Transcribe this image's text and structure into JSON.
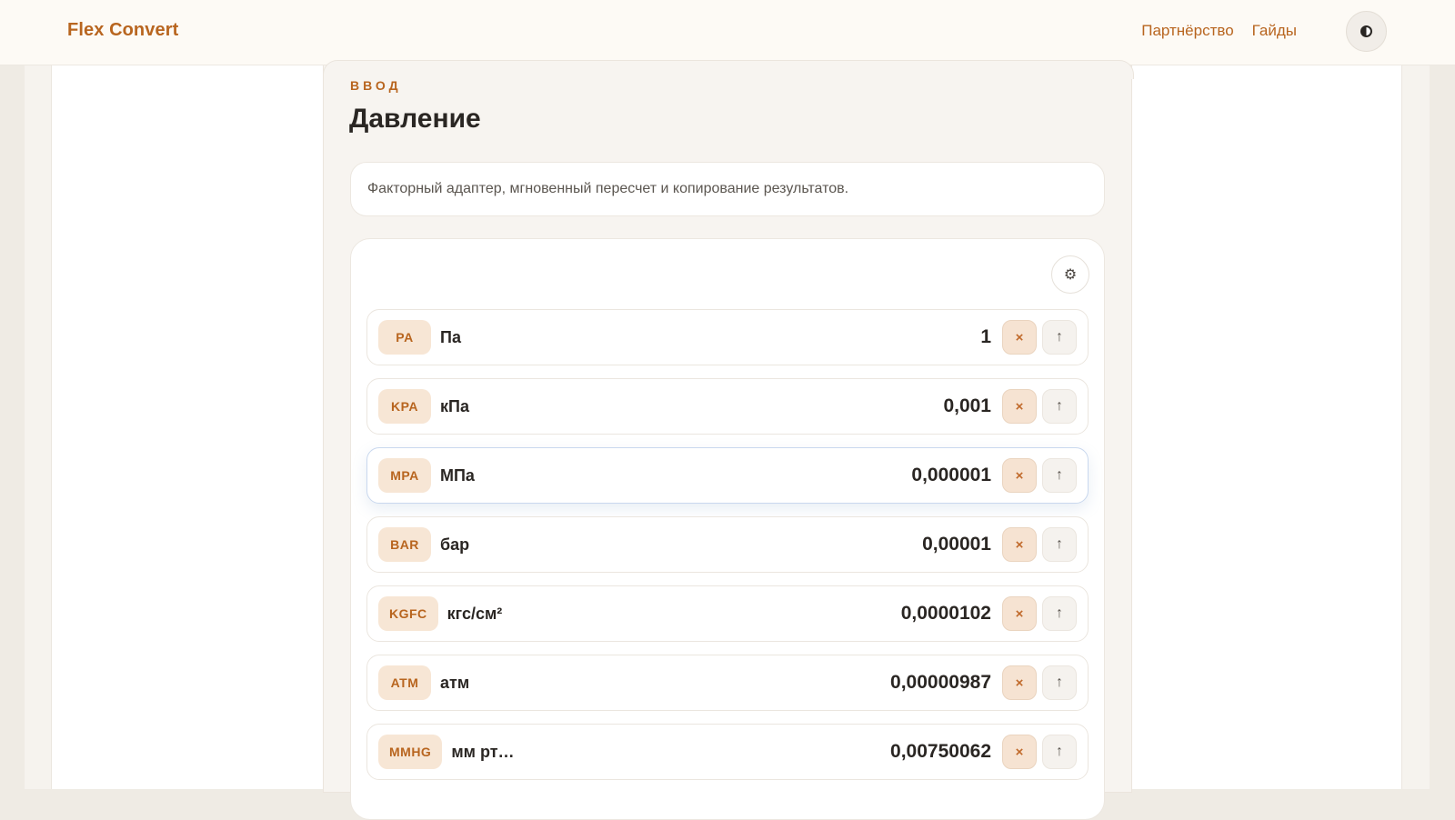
{
  "header": {
    "brand": "Flex Convert",
    "nav": [
      "Партнёрство",
      "Гайды"
    ],
    "theme_icon": "contrast-icon"
  },
  "section": {
    "eyebrow": "ВВОД",
    "title": "Давление",
    "description": "Факторный адаптер, мгновенный пересчет и копирование результатов."
  },
  "settings_icon": "gear-icon",
  "rows": [
    {
      "badge": "PA",
      "unit": "Па",
      "value": "1",
      "active": false
    },
    {
      "badge": "KPA",
      "unit": "кПа",
      "value": "0,001",
      "active": false
    },
    {
      "badge": "MPA",
      "unit": "МПа",
      "value": "0,000001",
      "active": true
    },
    {
      "badge": "BAR",
      "unit": "бар",
      "value": "0,00001",
      "active": false
    },
    {
      "badge": "KGFC",
      "unit": "кгс/см²",
      "value": "0,0000102",
      "active": false
    },
    {
      "badge": "ATM",
      "unit": "атм",
      "value": "0,00000987",
      "active": false
    },
    {
      "badge": "MMHG",
      "unit": "мм рт…",
      "value": "0,00750062",
      "active": false
    }
  ],
  "row_buttons": {
    "clear": "×",
    "up": "↑"
  },
  "colors": {
    "accent": "#b8651f",
    "active_border": "#c9d8ee"
  }
}
